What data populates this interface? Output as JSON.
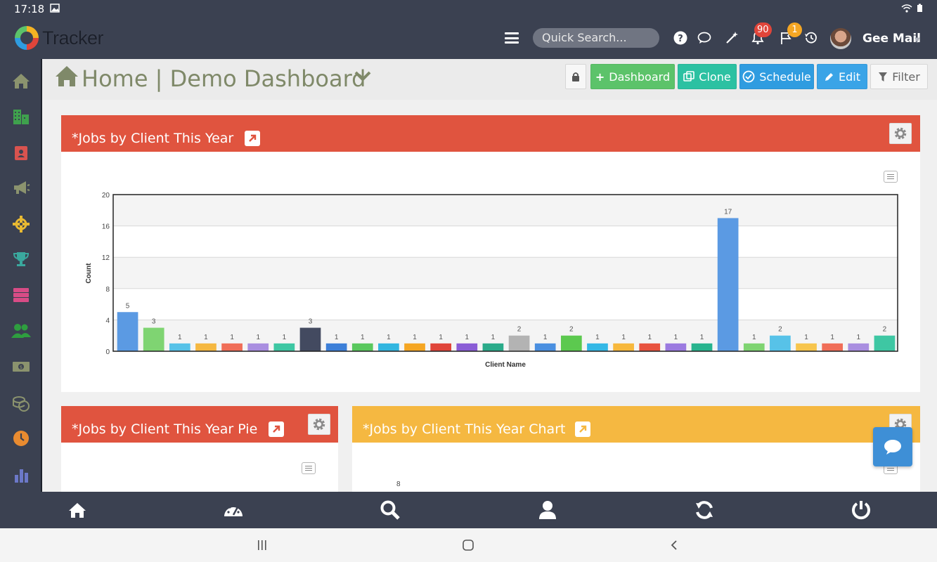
{
  "statusbar": {
    "time": "17:18"
  },
  "header": {
    "app_name": "Tracker",
    "search_placeholder": "Quick Search...",
    "notifications_count": "90",
    "flags_count": "1",
    "user_name": "Gee Mail"
  },
  "icons": {
    "header": [
      "menu-icon",
      "help-icon",
      "chat-bubble-icon",
      "magic-wand-icon",
      "bell-icon",
      "flag-icon",
      "history-icon"
    ],
    "sidebar": [
      "home-icon",
      "buildings-icon",
      "contacts-icon",
      "megaphone-icon",
      "crosshair-icon",
      "trophy-icon",
      "servers-icon",
      "users-icon",
      "money-icon",
      "coins-icon",
      "clock-icon",
      "bar-chart-icon"
    ],
    "bottomnav": [
      "home-icon",
      "dashboard-gauge-icon",
      "search-icon",
      "user-icon",
      "refresh-icon",
      "power-icon"
    ]
  },
  "colors": {
    "chrome": "#3b4151",
    "sidebar_icons": [
      "#8b936e",
      "#3fa14d",
      "#d9534f",
      "#8b936e",
      "#e8b932",
      "#3aa89e",
      "#d84c86",
      "#2e9e3f",
      "#8b936e",
      "#8b936e",
      "#e98b30",
      "#6c78c8"
    ],
    "widget_red": "#e0543f",
    "widget_yellow": "#f5b841",
    "bar_colors": [
      "#5b9ae3",
      "#7fd472",
      "#57c2e8",
      "#f5b841",
      "#f06e58",
      "#a98ee0",
      "#3ec7a3",
      "#434a60",
      "#3d7fd8",
      "#5ac85e",
      "#32b6e0",
      "#f5a623",
      "#e0453a",
      "#8a5dd6",
      "#2bab8a",
      "#b3b3b3",
      "#4a8fe0",
      "#5cc94f",
      "#34b8e6",
      "#f7b83c",
      "#e8533f",
      "#9b7ae0",
      "#28b48e",
      "#5b9ae3",
      "#7fd472",
      "#57c2e8",
      "#f7c54d",
      "#f06e58",
      "#a98ee0",
      "#3ec7a3"
    ]
  },
  "breadcrumb": {
    "title": "Home | Demo Dashboard"
  },
  "toolbar": {
    "dashboard_label": "Dashboard",
    "clone_label": "Clone",
    "schedule_label": "Schedule",
    "edit_label": "Edit",
    "filter_label": "Filter"
  },
  "widgets": {
    "bar": {
      "title": "*Jobs by Client This Year"
    },
    "pie": {
      "title": "*Jobs by Client This Year Pie"
    },
    "chart": {
      "title": "*Jobs by Client This Year Chart",
      "partial_label": "8"
    }
  },
  "chart_data": {
    "type": "bar",
    "xlabel": "Client Name",
    "ylabel": "Count",
    "ylim": [
      0,
      20
    ],
    "yticks": [
      0,
      4,
      8,
      12,
      16,
      20
    ],
    "grid": true,
    "values": [
      5,
      3,
      1,
      1,
      1,
      1,
      1,
      3,
      1,
      1,
      1,
      1,
      1,
      1,
      1,
      2,
      1,
      2,
      1,
      1,
      1,
      1,
      1,
      17,
      1,
      2,
      1,
      1,
      1,
      2
    ]
  }
}
